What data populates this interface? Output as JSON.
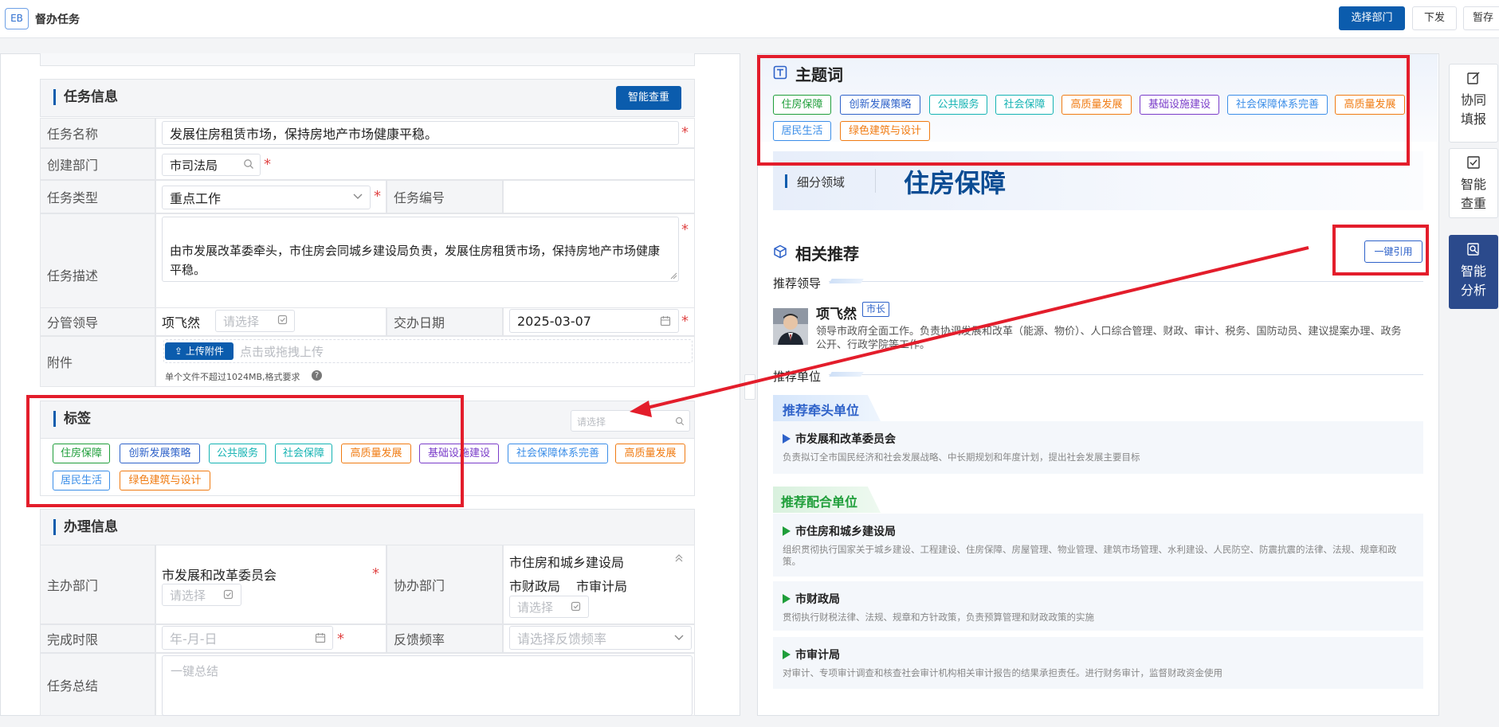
{
  "app": {
    "logo": "EB",
    "title": "督办任务"
  },
  "toolbar": {
    "select_dept": "选择部门",
    "issue": "下发",
    "save_draft": "暂存"
  },
  "task_info": {
    "section_title": "任务信息",
    "smart_check": "智能查重",
    "name_label": "任务名称",
    "name_value": "发展住房租赁市场，保持房地产市场健康平稳。",
    "dept_label": "创建部门",
    "dept_value": "市司法局",
    "type_label": "任务类型",
    "type_value": "重点工作",
    "code_label": "任务编号",
    "desc_label": "任务描述",
    "desc_value": "由市发展改革委牵头，市住房会同城乡建设局负责，发展住房租赁市场，保持房地产市场健康平稳。",
    "leader_label": "分管领导",
    "leader_value": "项飞然",
    "leader_placeholder": "请选择",
    "date_label": "交办日期",
    "date_value": "2025-03-07",
    "attach_label": "附件",
    "upload_button": "上传附件",
    "upload_hint": "点击或拖拽上传",
    "file_note": "单个文件不超过1024MB,格式要求"
  },
  "tags_section": {
    "title": "标签",
    "search_placeholder": "请选择",
    "tags": [
      {
        "label": "住房保障",
        "color": "#1f9e3a"
      },
      {
        "label": "创新发展策略",
        "color": "#2e62c9"
      },
      {
        "label": "公共服务",
        "color": "#14b3b3"
      },
      {
        "label": "社会保障",
        "color": "#14b3b3"
      },
      {
        "label": "高质量发展",
        "color": "#f07b12"
      },
      {
        "label": "基础设施建设",
        "color": "#7a3cc9"
      },
      {
        "label": "社会保障体系完善",
        "color": "#3b8ee8"
      },
      {
        "label": "高质量发展",
        "color": "#f07b12"
      },
      {
        "label": "居民生活",
        "color": "#3b8ee8"
      },
      {
        "label": "绿色建筑与设计",
        "color": "#f07b12"
      }
    ]
  },
  "handling": {
    "title": "办理信息",
    "lead_dept_label": "主办部门",
    "lead_dept_value": "市发展和改革委员会",
    "lead_placeholder": "请选择",
    "assist_label": "协办部门",
    "assist_values": [
      "市住房和城乡建设局",
      "市财政局",
      "市审计局"
    ],
    "assist_placeholder": "请选择",
    "deadline_label": "完成时限",
    "deadline_placeholder": "年-月-日",
    "freq_label": "反馈频率",
    "freq_placeholder": "请选择反馈频率",
    "summary_label": "任务总结",
    "summary_placeholder": "一键总结"
  },
  "keywords": {
    "title": "主题词",
    "tags": [
      {
        "label": "住房保障",
        "color": "#1f9e3a"
      },
      {
        "label": "创新发展策略",
        "color": "#2e62c9"
      },
      {
        "label": "公共服务",
        "color": "#14b3b3"
      },
      {
        "label": "社会保障",
        "color": "#14b3b3"
      },
      {
        "label": "高质量发展",
        "color": "#f07b12"
      },
      {
        "label": "基础设施建设",
        "color": "#7a3cc9"
      },
      {
        "label": "社会保障体系完善",
        "color": "#3b8ee8"
      },
      {
        "label": "高质量发展",
        "color": "#f07b12"
      },
      {
        "label": "居民生活",
        "color": "#3b8ee8"
      },
      {
        "label": "绿色建筑与设计",
        "color": "#f07b12"
      }
    ],
    "subfield_label": "细分领域",
    "subfield_value": "住房保障"
  },
  "recommend": {
    "title": "相关推荐",
    "cite_button": "一键引用",
    "leader_heading": "推荐领导",
    "leader_name": "项飞然",
    "leader_role": "市长",
    "leader_desc": "领导市政府全面工作。负责协调发展和改革（能源、物价）、人口综合管理、财政、审计、税务、国防动员、建议提案办理、政务公开、行政学院等工作。",
    "unit_heading": "推荐单位",
    "lead_unit_title": "推荐牵头单位",
    "lead_units": [
      {
        "name": "市发展和改革委员会",
        "desc": "负责拟订全市国民经济和社会发展战略、中长期规划和年度计划，提出社会发展主要目标"
      }
    ],
    "coop_unit_title": "推荐配合单位",
    "coop_units": [
      {
        "name": "市住房和城乡建设局",
        "desc": "组织贯彻执行国家关于城乡建设、工程建设、住房保障、房屋管理、物业管理、建筑市场管理、水利建设、人民防空、防震抗震的法律、法规、规章和政策。"
      },
      {
        "name": "市财政局",
        "desc": "贯彻执行财税法律、法规、规章和方针政策，负责预算管理和财政政策的实施"
      },
      {
        "name": "市审计局",
        "desc": "对审计、专项审计调查和核查社会审计机构相关审计报告的结果承担责任。进行财务审计，监督财政资金使用"
      }
    ]
  },
  "side_actions": {
    "collab": "协同填报",
    "dup_check": "智能查重",
    "analysis": "智能分析"
  },
  "colors": {
    "primary": "#0b5cad",
    "annotation_red": "#e31d2b",
    "side_active": "#2b4a8c"
  }
}
